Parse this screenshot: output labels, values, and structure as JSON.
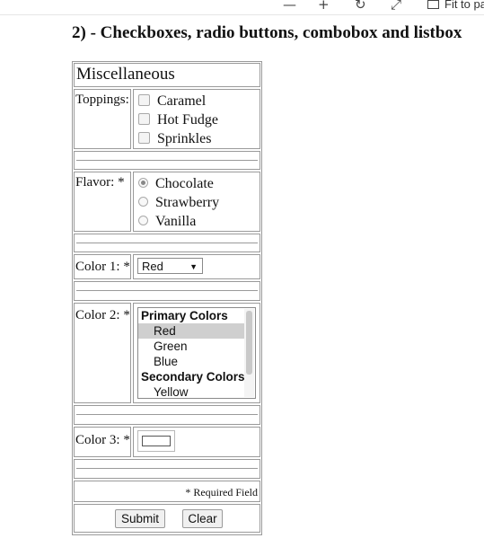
{
  "toolbar": {
    "fit_label": "Fit to pa"
  },
  "heading": "2) - Checkboxes, radio buttons, combobox and listbox",
  "form": {
    "section_title": "Miscellaneous",
    "toppings": {
      "label": "Toppings:",
      "options": [
        "Caramel",
        "Hot Fudge",
        "Sprinkles"
      ]
    },
    "flavor": {
      "label": "Flavor: *",
      "options": [
        "Chocolate",
        "Strawberry",
        "Vanilla"
      ],
      "selected": "Chocolate"
    },
    "color1": {
      "label": "Color 1: *",
      "selected_value": "Red"
    },
    "color2": {
      "label": "Color 2: *",
      "groups": [
        {
          "label": "Primary Colors",
          "options": [
            "Red",
            "Green",
            "Blue"
          ]
        },
        {
          "label": "Secondary Colors",
          "options": [
            "Yellow"
          ]
        }
      ],
      "selected": "Red"
    },
    "color3": {
      "label": "Color 3: *",
      "value_color": "#ffffff"
    },
    "required_note": "* Required Field",
    "submit_label": "Submit",
    "clear_label": "Clear"
  }
}
